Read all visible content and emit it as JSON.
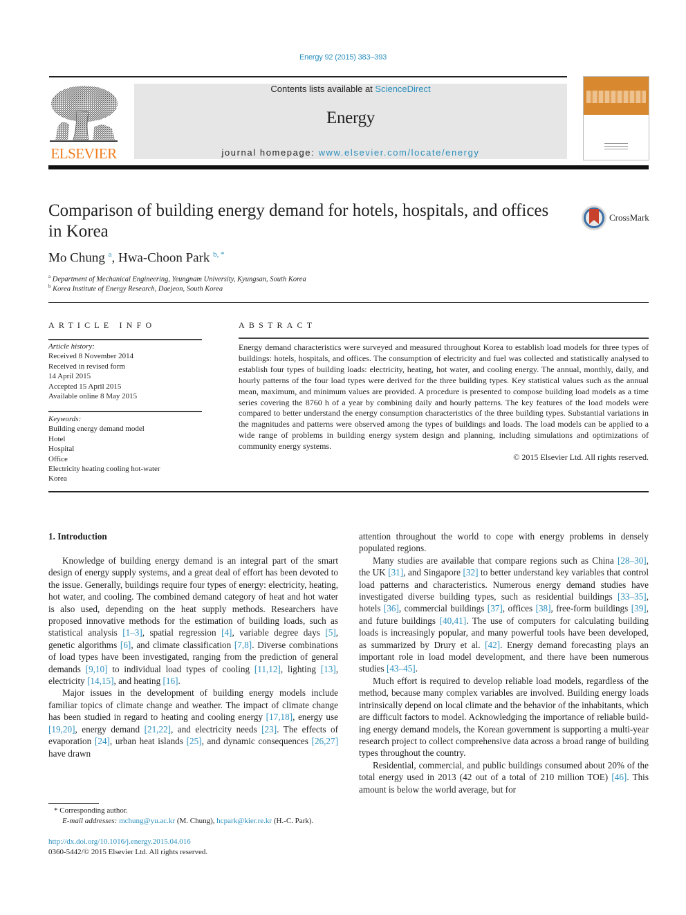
{
  "header": {
    "citation": "Energy 92 (2015) 383–393",
    "contents_prefix": "Contents lists available at ",
    "contents_link": "ScienceDirect",
    "journal_title": "Energy",
    "homepage_prefix": "journal homepage: ",
    "homepage_link": "www.elsevier.com/locate/energy",
    "publisher_logo_text": "ELSEVIER",
    "cover_icon": "journal-cover",
    "accent_color": "#2a8fbd",
    "publisher_color": "#f07c1c"
  },
  "article": {
    "title": "Comparison of building energy demand for hotels, hospitals, and offices in Korea",
    "crossmark_label": "CrossMark",
    "authors": [
      {
        "name": "Mo Chung",
        "sup": "a"
      },
      {
        "name": "Hwa-Choon Park",
        "sup": "b, *"
      }
    ],
    "affiliations": [
      {
        "sup": "a",
        "text": "Department of Mechanical Engineering, Yeungnam University, Kyungsan, South Korea"
      },
      {
        "sup": "b",
        "text": "Korea Institute of Energy Research, Daejeon, South Korea"
      }
    ]
  },
  "article_info": {
    "heading": "ARTICLE INFO",
    "history_label": "Article history:",
    "history": [
      "Received 8 November 2014",
      "Received in revised form",
      "14 April 2015",
      "Accepted 15 April 2015",
      "Available online 8 May 2015"
    ],
    "keywords_label": "Keywords:",
    "keywords": [
      "Building energy demand model",
      "Hotel",
      "Hospital",
      "Office",
      "Electricity heating cooling hot-water",
      "Korea"
    ]
  },
  "abstract": {
    "heading": "ABSTRACT",
    "text": "Energy demand characteristics were surveyed and measured throughout Korea to establish load models for three types of buildings: hotels, hospitals, and offices. The consumption of electricity and fuel was collected and statistically analysed to establish four types of building loads: electricity, heating, hot water, and cooling energy. The annual, monthly, daily, and hourly patterns of the four load types were derived for the three building types. Key statistical values such as the annual mean, maximum, and minimum values are provided. A procedure is presented to compose building load models as a time series covering the 8760 h of a year by combining daily and hourly patterns. The key features of the load models were compared to better understand the energy consumption characteristics of the three building types. Substantial variations in the magnitudes and patterns were observed among the types of buildings and loads. The load models can be applied to a wide range of problems in building energy system design and planning, including simulations and optimizations of community energy systems.",
    "copyright": "© 2015 Elsevier Ltd. All rights reserved."
  },
  "body": {
    "section_heading": "1.  Introduction",
    "left_paragraphs": [
      [
        {
          "t": "Knowledge of building energy demand is an integral part of the smart design of energy supply systems, and a great deal of effort has been devoted to the issue. Generally, buildings require four types of energy: electricity, heating, hot water, and cooling. The combined demand category of heat and hot water is also used, depending on the heat supply methods. Researchers have proposed innovative methods for the estimation of building loads, such as statistical analysis "
        },
        {
          "r": "[1–3]"
        },
        {
          "t": ", spatial regression "
        },
        {
          "r": "[4]"
        },
        {
          "t": ", variable degree days "
        },
        {
          "r": "[5]"
        },
        {
          "t": ", genetic algorithms "
        },
        {
          "r": "[6]"
        },
        {
          "t": ", and climate classification "
        },
        {
          "r": "[7,8]"
        },
        {
          "t": ". Diverse combinations of load types have been investigated, ranging from the prediction of general demands "
        },
        {
          "r": "[9,10]"
        },
        {
          "t": " to individual load types of cooling "
        },
        {
          "r": "[11,12]"
        },
        {
          "t": ", lighting "
        },
        {
          "r": "[13]"
        },
        {
          "t": ", electricity "
        },
        {
          "r": "[14,15]"
        },
        {
          "t": ", and heating "
        },
        {
          "r": "[16]"
        },
        {
          "t": "."
        }
      ],
      [
        {
          "t": "Major issues in the development of building energy models include familiar topics of climate change and weather. The impact of climate change has been studied in regard to heating and cooling energy "
        },
        {
          "r": "[17,18]"
        },
        {
          "t": ", energy use "
        },
        {
          "r": "[19,20]"
        },
        {
          "t": ", energy demand "
        },
        {
          "r": "[21,22]"
        },
        {
          "t": ", and electricity needs "
        },
        {
          "r": "[23]"
        },
        {
          "t": ". The effects of evaporation "
        },
        {
          "r": "[24]"
        },
        {
          "t": ", urban heat islands "
        },
        {
          "r": "[25]"
        },
        {
          "t": ", and dynamic consequences "
        },
        {
          "r": "[26,27]"
        },
        {
          "t": " have drawn"
        }
      ]
    ],
    "right_paragraphs": [
      [
        {
          "t": "attention throughout the world to cope with energy problems in densely populated regions."
        }
      ],
      [
        {
          "t": "Many studies are available that compare regions such as China "
        },
        {
          "r": "[28–30]"
        },
        {
          "t": ", the UK "
        },
        {
          "r": "[31]"
        },
        {
          "t": ", and Singapore "
        },
        {
          "r": "[32]"
        },
        {
          "t": " to better understand key variables that control load patterns and characteristics. Numerous energy demand studies have investigated diverse building types, such as residential buildings "
        },
        {
          "r": "[33–35]"
        },
        {
          "t": ", hotels "
        },
        {
          "r": "[36]"
        },
        {
          "t": ", commercial buildings "
        },
        {
          "r": "[37]"
        },
        {
          "t": ", offices "
        },
        {
          "r": "[38]"
        },
        {
          "t": ", free-form buildings "
        },
        {
          "r": "[39]"
        },
        {
          "t": ", and future buildings "
        },
        {
          "r": "[40,41]"
        },
        {
          "t": ". The use of computers for calculating building loads is increasingly popular, and many powerful tools have been developed, as summarized by Drury et al. "
        },
        {
          "r": "[42]"
        },
        {
          "t": ". Energy demand forecasting plays an important role in load model development, and there have been numerous studies "
        },
        {
          "r": "[43–45]"
        },
        {
          "t": "."
        }
      ],
      [
        {
          "t": "Much effort is required to develop reliable load models, regardless of the method, because many complex variables are involved. Building energy loads intrinsically depend on local climate and the behavior of the inhabitants, which are difficult factors to model. Acknowledging the importance of reliable build-ing energy demand models, the Korean government is supporting a multi-year research project to collect comprehensive data across a broad range of building types throughout the country."
        }
      ],
      [
        {
          "t": "Residential, commercial, and public buildings consumed about 20% of the total energy used in 2013 (42 out of a total of 210 million TOE) "
        },
        {
          "r": "[46]"
        },
        {
          "t": ". This amount is below the world average, but for"
        }
      ]
    ]
  },
  "footnotes": {
    "corresponding": "* Corresponding author.",
    "email_label": "E-mail addresses: ",
    "emails": [
      {
        "address": "mchung@yu.ac.kr",
        "who": " (M. Chung), "
      },
      {
        "address": "hcpark@kier.re.kr",
        "who": " (H.-C. Park)."
      }
    ],
    "doi": "http://dx.doi.org/10.1016/j.energy.2015.04.016",
    "issn_line": "0360-5442/© 2015 Elsevier Ltd. All rights reserved."
  }
}
